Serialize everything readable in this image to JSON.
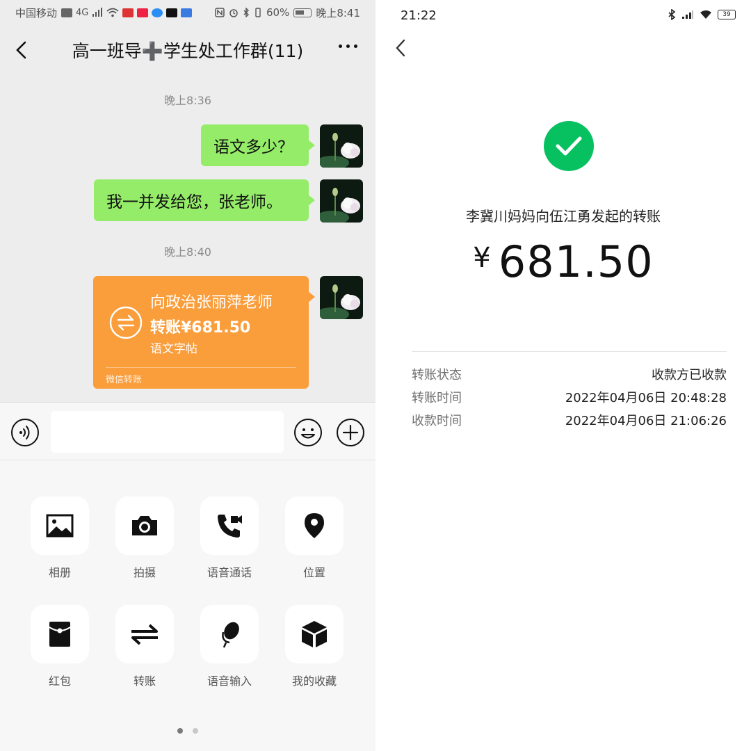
{
  "left": {
    "status_bar": {
      "carrier": "中国移动",
      "network": "4G",
      "battery": "60%",
      "time": "晚上8:41"
    },
    "header": {
      "title": "高一班导➕学生处工作群(11)"
    },
    "messages": [
      {
        "type": "time",
        "text": "晚上8:36"
      },
      {
        "type": "text",
        "text": "语文多少？"
      },
      {
        "type": "text",
        "text": "我一并发给您，张老师。"
      },
      {
        "type": "time",
        "text": "晚上8:40"
      }
    ],
    "transfer": {
      "line1": "向政治张丽萍老师",
      "line2": "转账¥681.50",
      "note": "语文字帖",
      "footer": "微信转账",
      "color": "#fa9d3b"
    },
    "input": {
      "value": "",
      "placeholder": ""
    },
    "tools": [
      {
        "label": "相册",
        "icon": "album-icon"
      },
      {
        "label": "拍摄",
        "icon": "camera-icon"
      },
      {
        "label": "语音通话",
        "icon": "voice-call-icon"
      },
      {
        "label": "位置",
        "icon": "location-icon"
      },
      {
        "label": "红包",
        "icon": "red-packet-icon"
      },
      {
        "label": "转账",
        "icon": "transfer-icon"
      },
      {
        "label": "语音输入",
        "icon": "microphone-icon"
      },
      {
        "label": "我的收藏",
        "icon": "favorites-icon"
      }
    ],
    "pager": {
      "pages": 2,
      "active": 0
    },
    "bubble_color": "#95ec69"
  },
  "right": {
    "status_bar": {
      "time": "21:22",
      "battery": "39"
    },
    "description": "李冀川妈妈向伍江勇发起的转账",
    "currency": "¥",
    "amount": "681.50",
    "details": [
      {
        "key": "转账状态",
        "value": "收款方已收款"
      },
      {
        "key": "转账时间",
        "value": "2022年04月06日 20:48:28"
      },
      {
        "key": "收款时间",
        "value": "2022年04月06日 21:06:26"
      }
    ],
    "accent": "#07c160"
  }
}
